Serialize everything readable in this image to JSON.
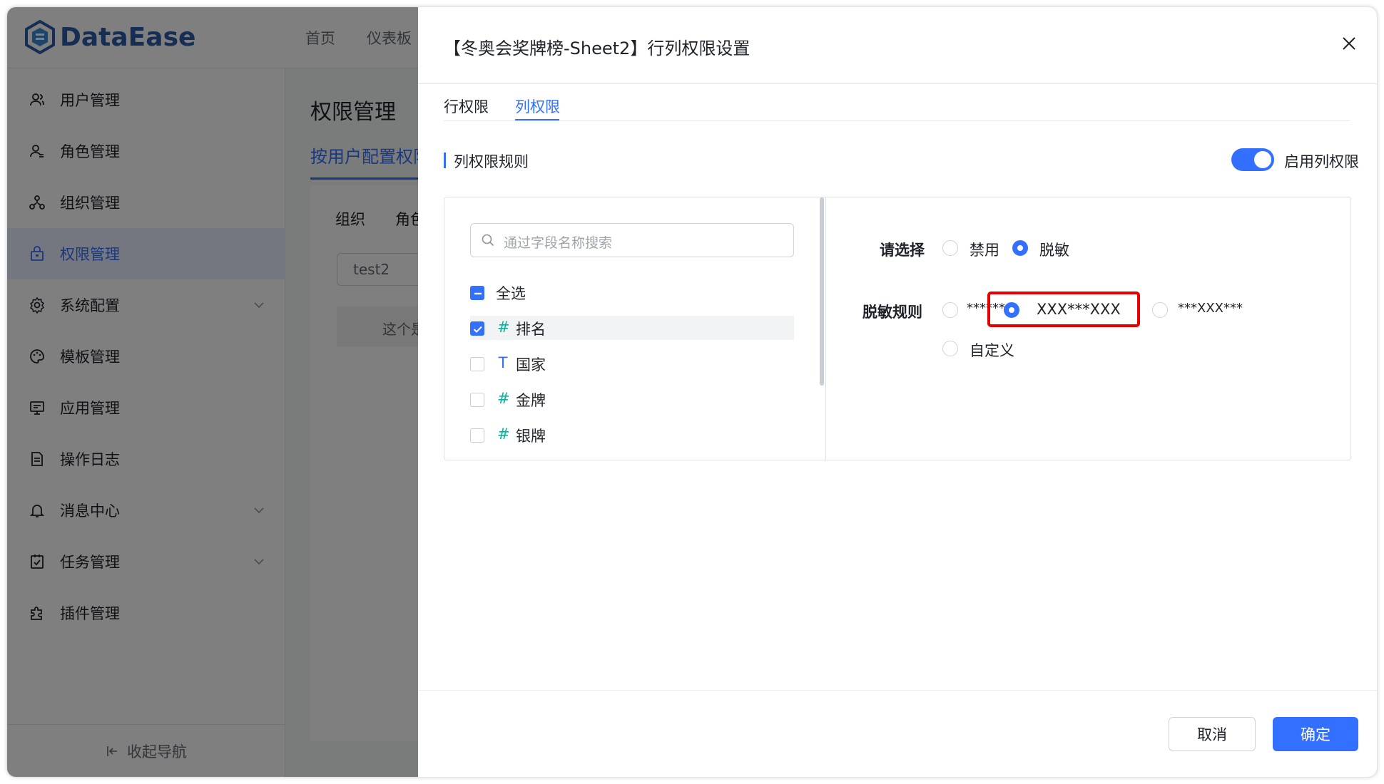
{
  "app": {
    "logo_text": "DataEase",
    "brand_color": "#2c5ba8",
    "top_nav": [
      "首页",
      "仪表板"
    ]
  },
  "sidebar": {
    "items": [
      {
        "label": "用户管理",
        "icon": "user-icon"
      },
      {
        "label": "角色管理",
        "icon": "role-icon"
      },
      {
        "label": "组织管理",
        "icon": "org-icon"
      },
      {
        "label": "权限管理",
        "icon": "lock-icon",
        "active": true
      },
      {
        "label": "系统配置",
        "icon": "gear-icon",
        "expandable": true
      },
      {
        "label": "模板管理",
        "icon": "palette-icon"
      },
      {
        "label": "应用管理",
        "icon": "monitor-icon"
      },
      {
        "label": "操作日志",
        "icon": "log-icon"
      },
      {
        "label": "消息中心",
        "icon": "bell-icon",
        "expandable": true
      },
      {
        "label": "任务管理",
        "icon": "task-icon",
        "expandable": true
      },
      {
        "label": "插件管理",
        "icon": "plugin-icon"
      }
    ],
    "collapse_label": "收起导航"
  },
  "main": {
    "title": "权限管理",
    "tab": "按用户配置权限",
    "inner_tabs": [
      "组织",
      "角色"
    ],
    "input_value": "test2",
    "note": "这个是"
  },
  "drawer": {
    "title": "【冬奥会奖牌榜-Sheet2】行列权限设置",
    "tabs": [
      "行权限",
      "列权限"
    ],
    "active_tab": "列权限",
    "section_title": "列权限规则",
    "switch_label": "启用列权限",
    "switch_on": true,
    "search_placeholder": "通过字段名称搜索",
    "select_all_label": "全选",
    "fields": [
      {
        "type": "#",
        "name": "排名",
        "checked": true
      },
      {
        "type": "T",
        "name": "国家",
        "checked": false
      },
      {
        "type": "#",
        "name": "金牌",
        "checked": false
      },
      {
        "type": "#",
        "name": "银牌",
        "checked": false
      }
    ],
    "choose_label": "请选择",
    "choose_options": [
      "禁用",
      "脱敏"
    ],
    "choose_selected": "脱敏",
    "rule_label": "脱敏规则",
    "rule_options": [
      "******",
      "XXX***XXX",
      "***XXX***",
      "自定义"
    ],
    "rule_selected": "XXX***XXX",
    "cancel_label": "取消",
    "confirm_label": "确定",
    "accent_color": "#3370ff",
    "highlight_color": "#e80000"
  }
}
